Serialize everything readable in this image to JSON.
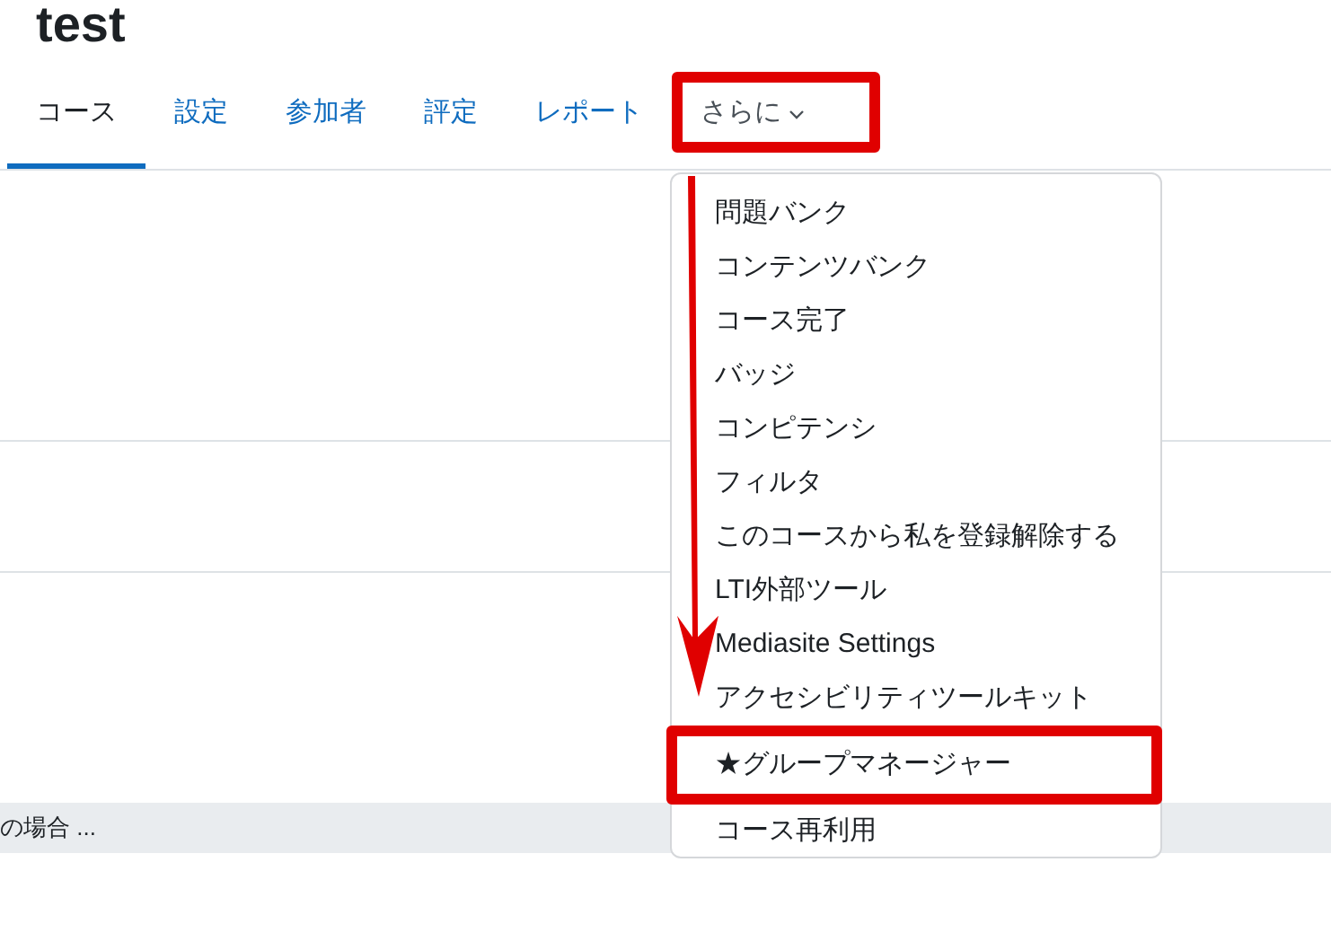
{
  "page_title": "test",
  "tabs": [
    {
      "label": "コース",
      "kind": "link",
      "selected": true,
      "annotated": false
    },
    {
      "label": "設定",
      "kind": "link",
      "selected": false,
      "annotated": false
    },
    {
      "label": "参加者",
      "kind": "link",
      "selected": false,
      "annotated": false
    },
    {
      "label": "評定",
      "kind": "link",
      "selected": false,
      "annotated": false
    },
    {
      "label": "レポート",
      "kind": "link",
      "selected": false,
      "annotated": false
    },
    {
      "label": "さらに",
      "kind": "dropdown",
      "selected": false,
      "annotated": true,
      "expanded": true
    }
  ],
  "more_menu": {
    "items": [
      {
        "label": "問題バンク",
        "annotated": false
      },
      {
        "label": "コンテンツバンク",
        "annotated": false
      },
      {
        "label": "コース完了",
        "annotated": false
      },
      {
        "label": "バッジ",
        "annotated": false
      },
      {
        "label": "コンピテンシ",
        "annotated": false
      },
      {
        "label": "フィルタ",
        "annotated": false
      },
      {
        "label": "このコースから私を登録解除する",
        "annotated": false
      },
      {
        "label": "LTI外部ツール",
        "annotated": false
      },
      {
        "label": "Mediasite Settings",
        "annotated": false
      },
      {
        "label": "アクセシビリティツールキット",
        "annotated": false
      },
      {
        "label": "★グループマネージャー",
        "annotated": true
      },
      {
        "label": "コース再利用",
        "annotated": false
      }
    ]
  },
  "footer_bar": {
    "text": "の場合 ..."
  }
}
